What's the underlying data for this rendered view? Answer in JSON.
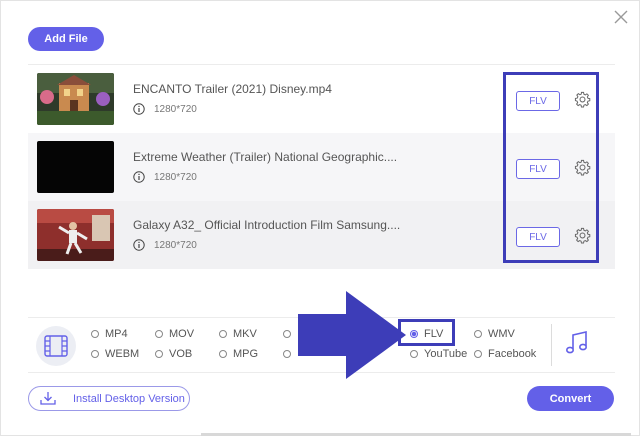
{
  "toolbar": {
    "add_file_label": "Add File"
  },
  "files": [
    {
      "name": "ENCANTO Trailer (2021) Disney.mp4",
      "resolution": "1280*720",
      "format": "FLV"
    },
    {
      "name": "Extreme Weather (Trailer) National Geographic....",
      "resolution": "1280*720",
      "format": "FLV"
    },
    {
      "name": "Galaxy A32_ Official Introduction Film Samsung....",
      "resolution": "1280*720",
      "format": "FLV"
    }
  ],
  "formats": {
    "mp4": "MP4",
    "mov": "MOV",
    "mkv": "MKV",
    "flv": "FLV",
    "wmv": "WMV",
    "webm": "WEBM",
    "vob": "VOB",
    "mpg": "MPG",
    "youtube": "YouTube",
    "facebook": "Facebook",
    "selected": "FLV"
  },
  "footer": {
    "install_label": "Install Desktop Version",
    "convert_label": "Convert"
  },
  "colors": {
    "accent": "#6360e8",
    "highlight": "#3d3db8"
  },
  "icons": [
    "close-icon",
    "info-icon",
    "gear-icon",
    "film-icon",
    "music-note-icon",
    "download-icon",
    "arrow-right-icon"
  ]
}
